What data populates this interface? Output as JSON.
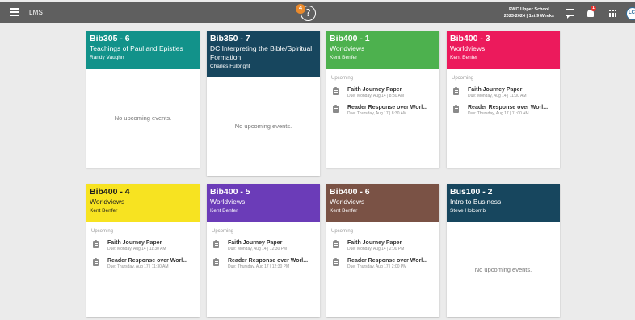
{
  "topbar": {
    "app_name": "LMS",
    "help_badge_count": "4",
    "help_symbol": "?",
    "school_line1": "FWC Upper School",
    "school_line2": "2023-2024 | 1st 9 Weeks",
    "notification_count": "1",
    "avatar_initials": "LC"
  },
  "labels": {
    "upcoming": "Upcoming",
    "no_events": "No upcoming events."
  },
  "colors": {
    "teal": "#12928a",
    "navy": "#17465e",
    "green": "#4db14e",
    "pink": "#ec1a5c",
    "yellow": "#f7e321",
    "purple": "#6b3cb8",
    "brown": "#7a5245"
  },
  "courses": [
    {
      "code": "Bib305 - 6",
      "name": "Teachings of Paul and Epistles",
      "instructor": "Randy Vaughn",
      "color": "#12928a",
      "events": []
    },
    {
      "code": "Bib350 - 7",
      "name": "DC Interpreting the Bible/Spiritual Formation",
      "instructor": "Charles Fulbright",
      "color": "#17465e",
      "events": []
    },
    {
      "code": "Bib400 - 1",
      "name": "Worldviews",
      "instructor": "Kent Benfer",
      "color": "#4db14e",
      "events": [
        {
          "title": "Faith Journey Paper",
          "due": "Due: Monday, Aug 14 | 8:30 AM"
        },
        {
          "title": "Reader Response over Worl...",
          "due": "Due: Thursday, Aug 17 | 8:30 AM"
        }
      ]
    },
    {
      "code": "Bib400 - 3",
      "name": "Worldviews",
      "instructor": "Kent Benfer",
      "color": "#ec1a5c",
      "events": [
        {
          "title": "Faith Journey Paper",
          "due": "Due: Monday, Aug 14 | 11:00 AM"
        },
        {
          "title": "Reader Response over Worl...",
          "due": "Due: Thursday, Aug 17 | 11:00 AM"
        }
      ]
    },
    {
      "code": "Bib400 - 4",
      "name": "Worldviews",
      "instructor": "Kent Benfer",
      "color": "#f7e321",
      "dark_text": true,
      "events": [
        {
          "title": "Faith Journey Paper",
          "due": "Due: Monday, Aug 14 | 11:30 AM"
        },
        {
          "title": "Reader Response over Worl...",
          "due": "Due: Thursday, Aug 17 | 11:30 AM"
        }
      ]
    },
    {
      "code": "Bib400 - 5",
      "name": "Worldviews",
      "instructor": "Kent Benfer",
      "color": "#6b3cb8",
      "events": [
        {
          "title": "Faith Journey Paper",
          "due": "Due: Monday, Aug 14 | 12:30 PM"
        },
        {
          "title": "Reader Response over Worl...",
          "due": "Due: Thursday, Aug 17 | 12:30 PM"
        }
      ]
    },
    {
      "code": "Bib400 - 6",
      "name": "Worldviews",
      "instructor": "Kent Benfer",
      "color": "#7a5245",
      "events": [
        {
          "title": "Faith Journey Paper",
          "due": "Due: Monday, Aug 14 | 2:00 PM"
        },
        {
          "title": "Reader Response over Worl...",
          "due": "Due: Thursday, Aug 17 | 2:00 PM"
        }
      ]
    },
    {
      "code": "Bus100 - 2",
      "name": "Intro to Business",
      "instructor": "Steve Holcomb",
      "color": "#17465e",
      "events": []
    }
  ]
}
